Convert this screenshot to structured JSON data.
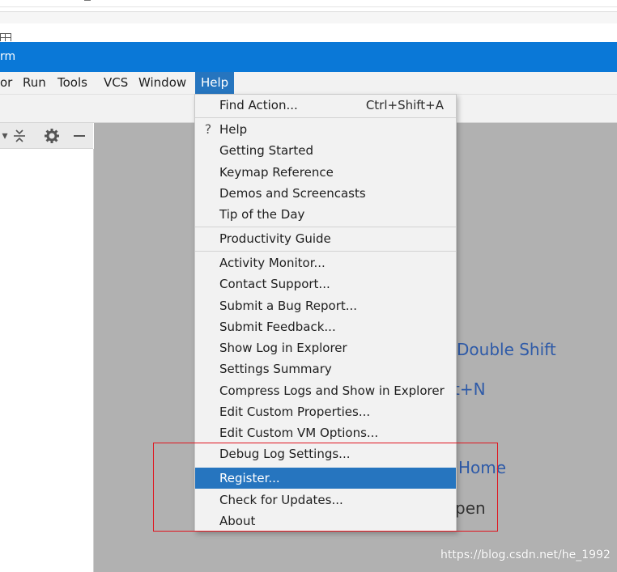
{
  "window": {
    "title_fragment": "rm"
  },
  "menu_bar": {
    "items": [
      "or",
      "Run",
      "Tools",
      "VCS",
      "Window",
      "Help"
    ],
    "active": "Help"
  },
  "help_menu": {
    "find_action": {
      "label": "Find Action...",
      "shortcut": "Ctrl+Shift+A"
    },
    "group1": [
      "Help",
      "Getting Started",
      "Keymap Reference",
      "Demos and Screencasts",
      "Tip of the Day"
    ],
    "group2": [
      "Productivity Guide"
    ],
    "group3": [
      "Activity Monitor...",
      "Contact Support...",
      "Submit a Bug Report...",
      "Submit Feedback...",
      "Show Log in Explorer",
      "Settings Summary",
      "Compress Logs and Show in Explorer",
      "Edit Custom Properties...",
      "Edit Custom VM Options...",
      "Debug Log Settings...",
      "Register...",
      "Check for Updates...",
      "About"
    ],
    "selected": "Register..."
  },
  "editor_hints": {
    "search_everywhere": "Double Shift",
    "new_file_suffix": "t+N",
    "navigation_bar": "Home",
    "open_suffix": "pen"
  },
  "watermark": "https://blog.csdn.net/he_1992",
  "colors": {
    "title_bar": "#0a78d7",
    "selection": "#2675bf",
    "highlight_box": "#e0141e",
    "hint_text": "#2e5aa8"
  }
}
